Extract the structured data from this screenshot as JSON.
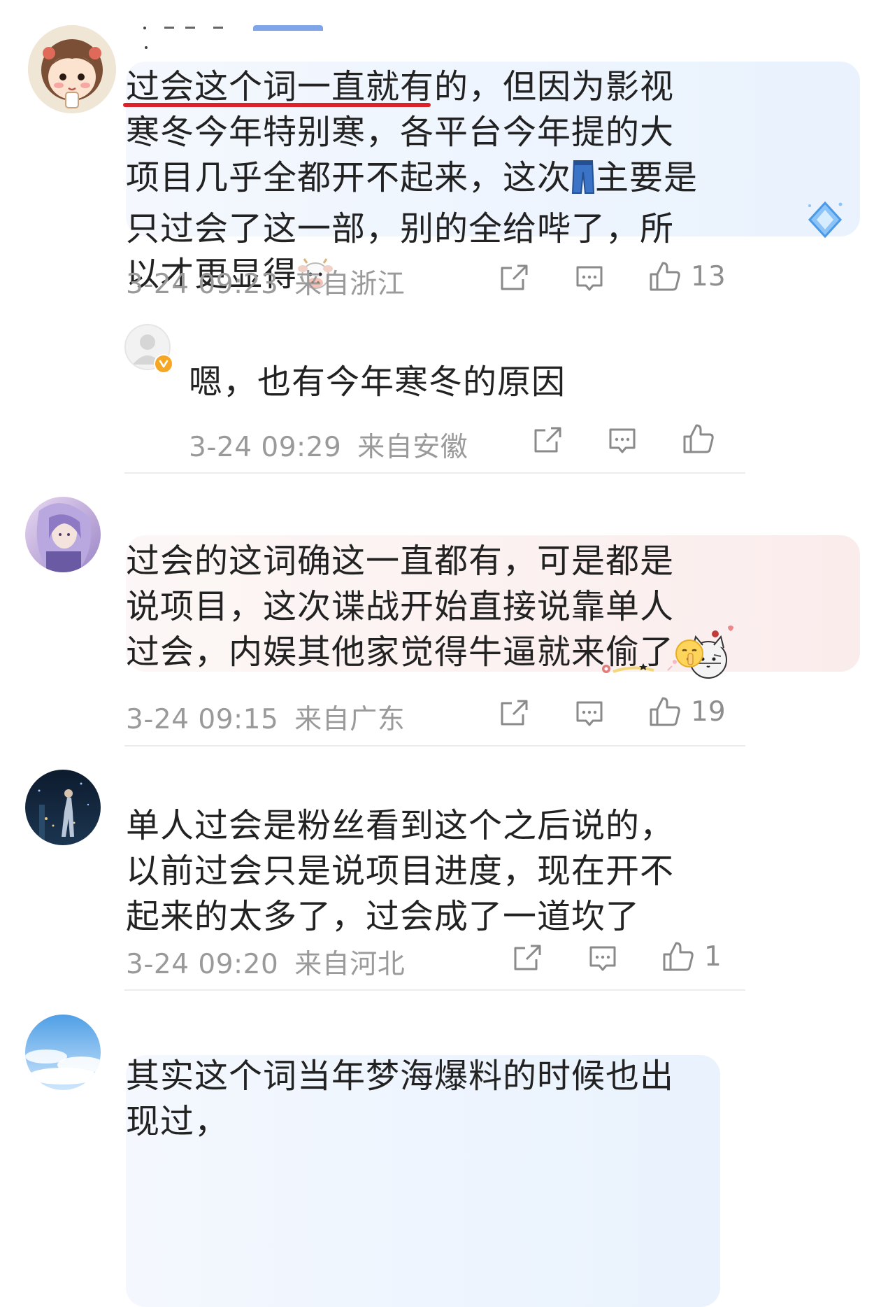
{
  "colors": {
    "highlight_underline": "#d8232a",
    "meta_text": "#9a9a9a",
    "bubble_blue": "#eef4fc",
    "bubble_pink": "#fdf0f0",
    "verified_badge": "#f5a623"
  },
  "comments": [
    {
      "text": "过会这个词一直就有的，但因为影视寒冬今年特别寒，各平台今年提的大项目几乎全都开不起来，这次",
      "text_after_emoji": "主要是只过会了这一部，别的全给哔了，所以才更显得",
      "emoji_1": "jeans-emoji",
      "emoji_2": "cow-face-emoji",
      "time": "3-24 09:23",
      "location": "来自浙江",
      "likes": "13",
      "reply": {
        "text": "嗯，也有今年寒冬的原因",
        "time": "3-24 09:29",
        "location": "来自安徽",
        "likes": ""
      }
    },
    {
      "text": "过会的这词确这一直都有，可是都是说项目，这次谍战开始直接说靠单人过会，内娱其他家觉得牛逼就来偷了",
      "emoji": "shushing-face-emoji",
      "time": "3-24 09:15",
      "location": "来自广东",
      "likes": "19"
    },
    {
      "text": "单人过会是粉丝看到这个之后说的，以前过会只是说项目进度，现在开不起来的太多了，过会成了一道坎了",
      "time": "3-24 09:20",
      "location": "来自河北",
      "likes": "1"
    },
    {
      "text": "其实这个词当年梦海爆料的时候也出现过，",
      "time": "",
      "location": "",
      "likes": ""
    }
  ]
}
